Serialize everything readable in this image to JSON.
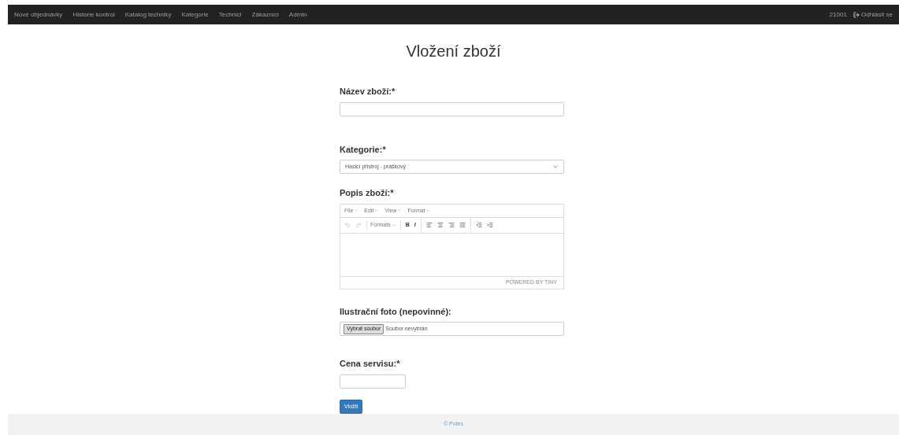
{
  "navbar": {
    "items": [
      {
        "label": "Nové objednávky"
      },
      {
        "label": "Historie kontrol"
      },
      {
        "label": "Katalog techniky"
      },
      {
        "label": "Kategorie"
      },
      {
        "label": "Technici"
      },
      {
        "label": "Zákazníci"
      },
      {
        "label": "Admin"
      }
    ],
    "user": "21001",
    "logout": "Odhlásit se"
  },
  "title": "Vložení zboží",
  "form": {
    "name_label": "Název zboží:*",
    "category_label": "Kategorie:*",
    "category_value": "Hasicí přístroj - práškový",
    "description_label": "Popis zboží:*",
    "editor": {
      "menu": [
        "File",
        "Edit",
        "View",
        "Format"
      ],
      "formats": "Formats",
      "bold": "B",
      "italic": "I",
      "branding": "POWERED BY TINY"
    },
    "photo_label": "Ilustrační foto (nepovinné):",
    "file_button": "Vybrat soubor",
    "file_status": "Soubor nevybrán",
    "price_label": "Cena servisu:*",
    "submit": "Vložit"
  },
  "footer": "© Potes"
}
